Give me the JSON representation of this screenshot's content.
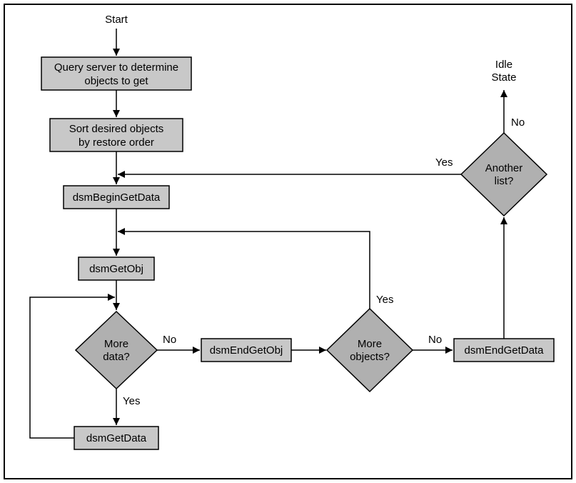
{
  "flowchart": {
    "start": "Start",
    "idle_state_line1": "Idle",
    "idle_state_line2": "State",
    "nodes": {
      "query_line1": "Query server to determine",
      "query_line2": "objects to get",
      "sort_line1": "Sort desired objects",
      "sort_line2": "by restore order",
      "begin_get_data": "dsmBeginGetData",
      "get_obj": "dsmGetObj",
      "more_data": "More",
      "more_data_2": "data?",
      "get_data": "dsmGetData",
      "end_get_obj": "dsmEndGetObj",
      "more_objects": "More",
      "more_objects_2": "objects?",
      "end_get_data": "dsmEndGetData",
      "another_list": "Another",
      "another_list_2": "list?"
    },
    "edges": {
      "yes": "Yes",
      "no": "No"
    }
  }
}
